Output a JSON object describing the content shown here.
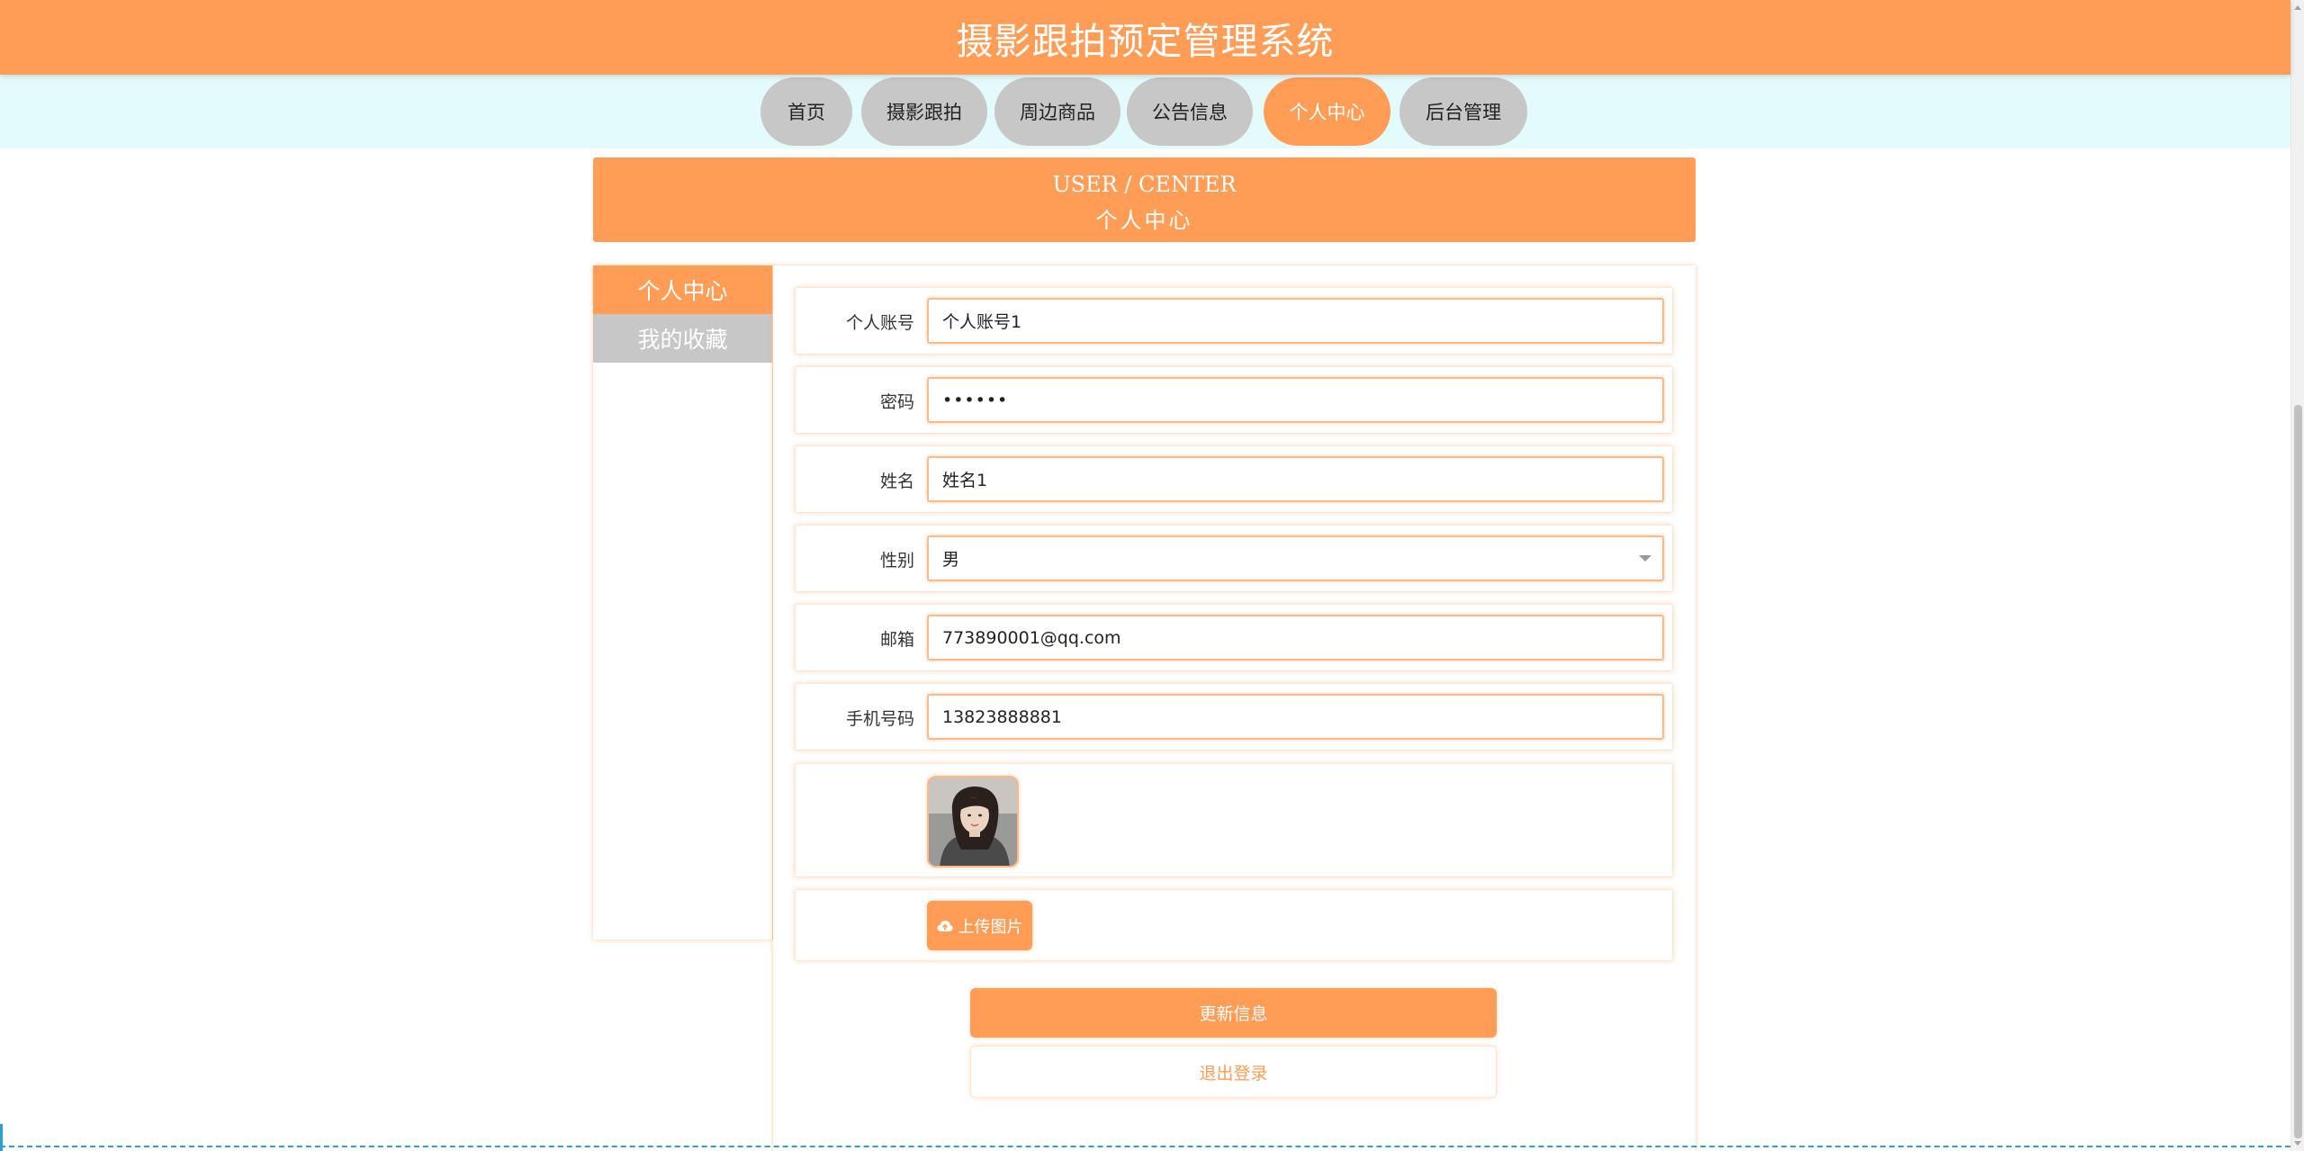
{
  "header": {
    "title": "摄影跟拍预定管理系统"
  },
  "nav": {
    "items": [
      {
        "label": "首页"
      },
      {
        "label": "摄影跟拍"
      },
      {
        "label": "周边商品"
      },
      {
        "label": "公告信息"
      },
      {
        "label": "个人中心"
      },
      {
        "label": "后台管理"
      }
    ],
    "active": "个人中心"
  },
  "banner": {
    "title_en": "USER / CENTER",
    "title_cn": "个人中心"
  },
  "sidebar": {
    "items": [
      {
        "label": "个人中心"
      },
      {
        "label": "我的收藏"
      }
    ]
  },
  "form": {
    "account": {
      "label": "个人账号",
      "value": "个人账号1"
    },
    "password": {
      "label": "密码",
      "value": "••••••"
    },
    "name": {
      "label": "姓名",
      "value": "姓名1"
    },
    "gender": {
      "label": "性别",
      "value": "男"
    },
    "email": {
      "label": "邮箱",
      "value": "773890001@qq.com"
    },
    "phone": {
      "label": "手机号码",
      "value": "13823888881"
    },
    "upload_label": "上传图片",
    "update_label": "更新信息",
    "logout_label": "退出登录"
  },
  "colors": {
    "accent": "#ff9d57",
    "nav_bg": "#e4fbfd",
    "inactive": "#c7c7c7"
  },
  "icons": {
    "upload": "cloud-upload-icon",
    "select_caret": "chevron-down-icon"
  }
}
